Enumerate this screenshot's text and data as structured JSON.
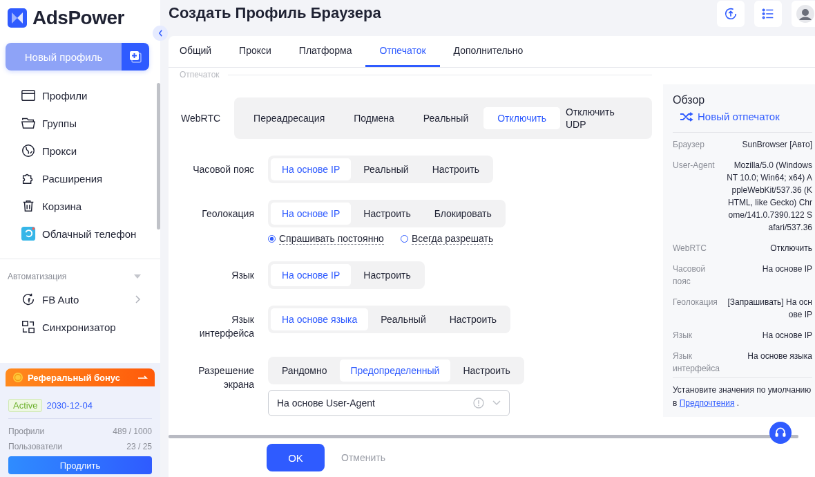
{
  "sidebar": {
    "logo": "AdsPower",
    "new_profile": "Новый профиль",
    "nav": [
      {
        "label": "Профили"
      },
      {
        "label": "Группы"
      },
      {
        "label": "Прокси"
      },
      {
        "label": "Расширения"
      },
      {
        "label": "Корзина"
      },
      {
        "label": "Облачный телефон"
      }
    ],
    "section": "Автоматизация",
    "automation": [
      {
        "label": "FB Auto",
        "has_submenu": true
      },
      {
        "label": "Синхронизатор",
        "has_submenu": false
      }
    ],
    "referral": {
      "title": "Реферальный бонус",
      "status": "Active",
      "date": "2030-12-04",
      "stats": [
        {
          "label": "Профили",
          "value": "489 / 1000"
        },
        {
          "label": "Пользователи",
          "value": "23 / 25"
        }
      ],
      "renew": "Продлить"
    }
  },
  "header": {
    "title": "Создать Профиль Браузера"
  },
  "tabs": [
    {
      "label": "Общий",
      "selected": false
    },
    {
      "label": "Прокси",
      "selected": false
    },
    {
      "label": "Платформа",
      "selected": false
    },
    {
      "label": "Отпечаток",
      "selected": true
    },
    {
      "label": "Дополнительно",
      "selected": false
    }
  ],
  "section_label": "Отпечаток",
  "form": [
    {
      "kind": "wide",
      "label": "WebRTC",
      "options": [
        {
          "label": "Переадресация",
          "selected": false
        },
        {
          "label": "Подмена",
          "selected": false
        },
        {
          "label": "Реальный",
          "selected": false
        },
        {
          "label": "Отключить",
          "selected": true
        },
        {
          "label": "Отключить UDP",
          "selected": false
        }
      ]
    },
    {
      "kind": "standard",
      "label": "Часовой пояс",
      "options": [
        {
          "label": "На основе IP",
          "selected": true
        },
        {
          "label": "Реальный",
          "selected": false
        },
        {
          "label": "Настроить",
          "selected": false
        }
      ]
    },
    {
      "kind": "standard",
      "label": "Геолокация",
      "options": [
        {
          "label": "На основе IP",
          "selected": true
        },
        {
          "label": "Настроить",
          "selected": false
        },
        {
          "label": "Блокировать",
          "selected": false
        }
      ],
      "radios": [
        {
          "label": "Спрашивать постоянно",
          "selected": true
        },
        {
          "label": "Всегда разрешать",
          "selected": false
        }
      ]
    },
    {
      "kind": "standard",
      "label": "Язык",
      "options": [
        {
          "label": "На основе IP",
          "selected": true
        },
        {
          "label": "Настроить",
          "selected": false
        }
      ]
    },
    {
      "kind": "standard",
      "label": "Язык интерфейса",
      "options": [
        {
          "label": "На основе языка",
          "selected": true
        },
        {
          "label": "Реальный",
          "selected": false
        },
        {
          "label": "Настроить",
          "selected": false
        }
      ]
    },
    {
      "kind": "standard",
      "label": "Разрешение экрана",
      "options": [
        {
          "label": "Рандомно",
          "selected": false
        },
        {
          "label": "Предопределенный",
          "selected": true
        },
        {
          "label": "Настроить",
          "selected": false
        }
      ],
      "select": {
        "value": "На основе User-Agent"
      }
    }
  ],
  "overview": {
    "title": "Обзор",
    "new_fingerprint": "Новый отпечаток",
    "rows": [
      {
        "label": "Браузер",
        "value": "SunBrowser [Авто]"
      },
      {
        "label": "User-Agent",
        "value": "Mozilla/5.0 (Windows NT 10.0; Win64; x64) AppleWebKit/537.36 (KHTML, like Gecko) Chrome/141.0.7390.122 Safari/537.36"
      },
      {
        "label": "WebRTC",
        "value": "Отключить"
      },
      {
        "label": "Часовой пояс",
        "value": "На основе IP"
      },
      {
        "label": "Геолокация",
        "value": "[Запрашивать] На основе IP"
      },
      {
        "label": "Язык",
        "value": "На основе IP"
      },
      {
        "label": "Язык интерфейса",
        "value": "На основе языка"
      }
    ],
    "note": {
      "before": "Установите значения по умолчанию в",
      "link": "Предпочтения",
      "after": "."
    }
  },
  "footer": {
    "ok": "OK",
    "cancel": "Отменить"
  }
}
